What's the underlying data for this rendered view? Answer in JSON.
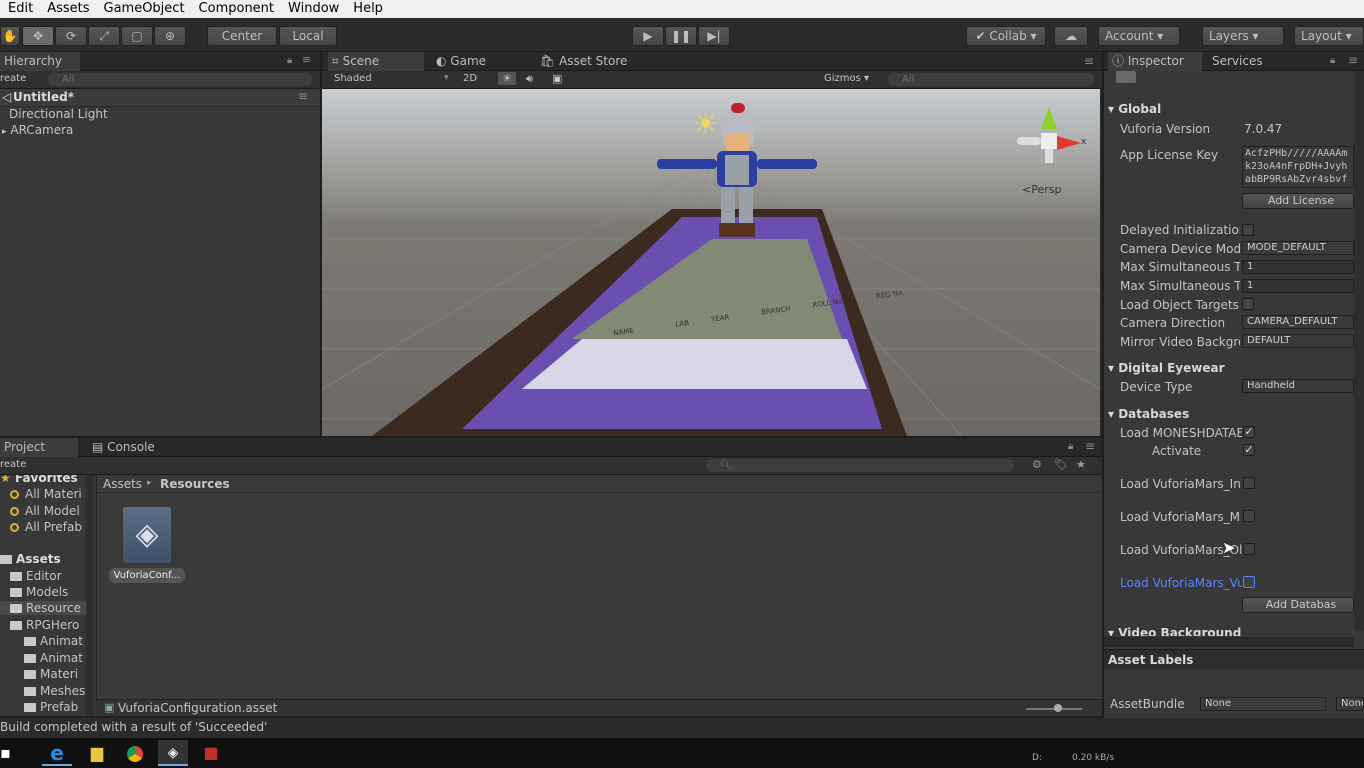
{
  "menu": [
    "Edit",
    "Assets",
    "GameObject",
    "Component",
    "Window",
    "Help"
  ],
  "toolbar": {
    "pivot": "Center",
    "space": "Local",
    "collab": "Collab",
    "account": "Account",
    "layers": "Layers",
    "layout": "Layout"
  },
  "hierarchy": {
    "tab": "Hierarchy",
    "create": "reate",
    "search_placeholder": "All",
    "scene": "Untitled*",
    "items": [
      "Directional Light",
      "ARCamera"
    ]
  },
  "scene_view": {
    "tabs": [
      "Scene",
      "Game",
      "Asset Store"
    ],
    "shading": "Shaded",
    "mode2d": "2D",
    "gizmos": "Gizmos",
    "search_placeholder": "All",
    "persp": "Persp",
    "marker_rows": [
      "NAME",
      "LAB",
      "YEAR",
      "BRANCH",
      "ROLL No.",
      "REG No."
    ]
  },
  "inspector": {
    "tabs": [
      "Inspector",
      "Services"
    ],
    "global_title": "Global",
    "vuforia_version_label": "Vuforia Version",
    "vuforia_version": "7.0.47",
    "license_label": "App License Key",
    "license_lines": [
      "AcfzPHb/////AAAAm",
      "k23oA4nFrpDH+Jvyh",
      "abBP9RsAbZvr4sbvf"
    ],
    "add_license": "Add License",
    "delayed_init": "Delayed Initializatior",
    "camera_device_mode_label": "Camera Device Mod",
    "camera_device_mode": "MODE_DEFAULT",
    "max_targets_1": "Max Simultaneous Tr",
    "max_targets_1_val": "1",
    "max_targets_2": "Max Simultaneous Tr",
    "max_targets_2_val": "1",
    "load_object_targets": "Load Object Targets",
    "camera_direction_label": "Camera Direction",
    "camera_direction": "CAMERA_DEFAULT",
    "mirror_label": "Mirror Video Backgro",
    "mirror": "DEFAULT",
    "eyewear_title": "Digital Eyewear",
    "device_type_label": "Device Type",
    "device_type": "Handheld",
    "databases_title": "Databases",
    "db_load_main": "Load MONESHDATAE",
    "activate": "Activate",
    "db_load_1": "Load VuforiaMars_In",
    "db_load_2": "Load VuforiaMars_M",
    "db_load_3": "Load VuforiaMars_Ol",
    "db_load_4": "Load VuforiaMars_Vu",
    "add_database": "Add Databas",
    "video_bg_title": "Video Background",
    "asset_labels": "Asset Labels",
    "asset_bundle_label": "AssetBundle",
    "asset_bundle": "None",
    "asset_bundle_variant": "None"
  },
  "project": {
    "tabs": [
      "Project",
      "Console"
    ],
    "create": "reate",
    "favorites_title": "Favorites",
    "favorites": [
      "All Materi",
      "All Model",
      "All Prefab"
    ],
    "assets_title": "Assets",
    "tree": [
      "Editor",
      "Models",
      "Resource",
      "RPGHero"
    ],
    "subtree": [
      "Animat",
      "Animat",
      "Materi",
      "Meshes",
      "Prefab"
    ],
    "breadcrumb_root": "Assets",
    "breadcrumb_current": "Resources",
    "asset_name": "VuforiaConf...",
    "selected_path": "VuforiaConfiguration.asset"
  },
  "status": "Build completed with a result of 'Succeeded'",
  "taskbar": {
    "net_left": "D:",
    "net_speed": "0.20 kB/s"
  },
  "colors": {
    "accent_selected": "#3d6bd1",
    "link_blue": "#5a84ff"
  }
}
